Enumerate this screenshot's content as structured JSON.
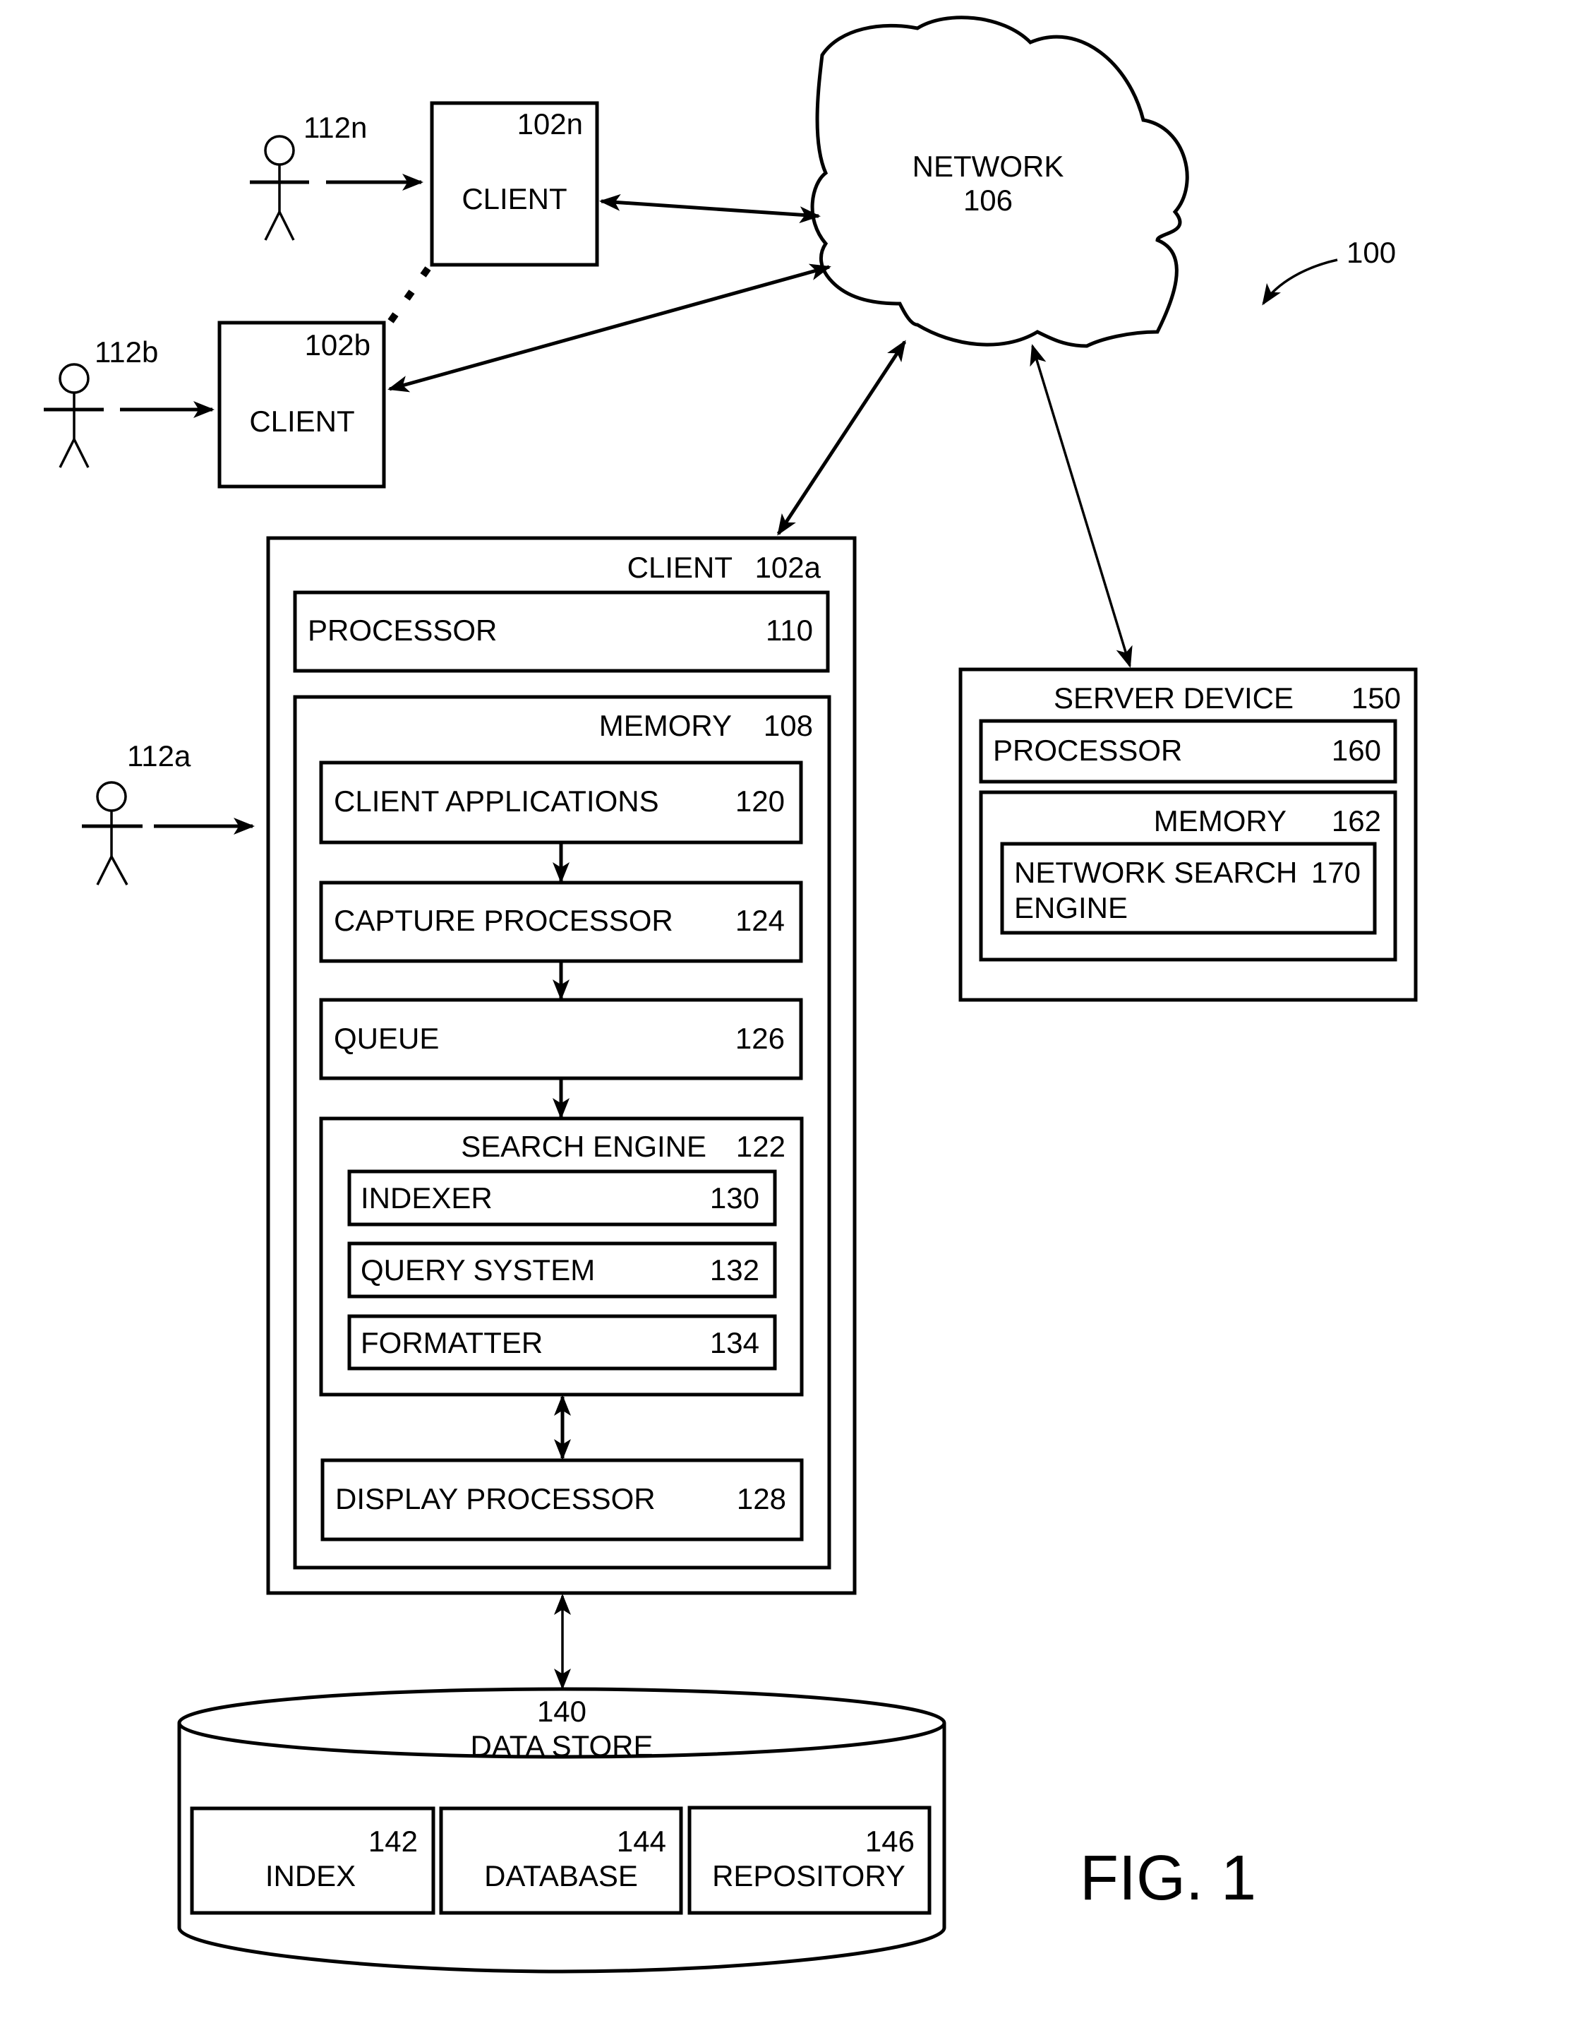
{
  "figure": {
    "title": "FIG. 1",
    "system_ref": "100"
  },
  "network": {
    "label": "NETWORK",
    "ref": "106"
  },
  "users": [
    {
      "ref": "112n"
    },
    {
      "ref": "112b"
    },
    {
      "ref": "112a"
    }
  ],
  "clients": {
    "n": {
      "label": "CLIENT",
      "ref": "102n"
    },
    "b": {
      "label": "CLIENT",
      "ref": "102b"
    },
    "a": {
      "label": "CLIENT",
      "ref": "102a",
      "processor": {
        "label": "PROCESSOR",
        "ref": "110"
      },
      "memory": {
        "label": "MEMORY",
        "ref": "108",
        "client_applications": {
          "label": "CLIENT APPLICATIONS",
          "ref": "120"
        },
        "capture_processor": {
          "label": "CAPTURE PROCESSOR",
          "ref": "124"
        },
        "queue": {
          "label": "QUEUE",
          "ref": "126"
        },
        "search_engine": {
          "label": "SEARCH ENGINE",
          "ref": "122",
          "indexer": {
            "label": "INDEXER",
            "ref": "130"
          },
          "query_system": {
            "label": "QUERY SYSTEM",
            "ref": "132"
          },
          "formatter": {
            "label": "FORMATTER",
            "ref": "134"
          }
        },
        "display_processor": {
          "label": "DISPLAY PROCESSOR",
          "ref": "128"
        }
      }
    }
  },
  "server": {
    "label": "SERVER DEVICE",
    "ref": "150",
    "processor": {
      "label": "PROCESSOR",
      "ref": "160"
    },
    "memory": {
      "label": "MEMORY",
      "ref": "162",
      "network_search_engine": {
        "label_line1": "NETWORK SEARCH",
        "label_line2": "ENGINE",
        "ref": "170"
      }
    }
  },
  "data_store": {
    "label": "DATA STORE",
    "ref": "140",
    "index": {
      "label": "INDEX",
      "ref": "142"
    },
    "database": {
      "label": "DATABASE",
      "ref": "144"
    },
    "repository": {
      "label": "REPOSITORY",
      "ref": "146"
    }
  }
}
